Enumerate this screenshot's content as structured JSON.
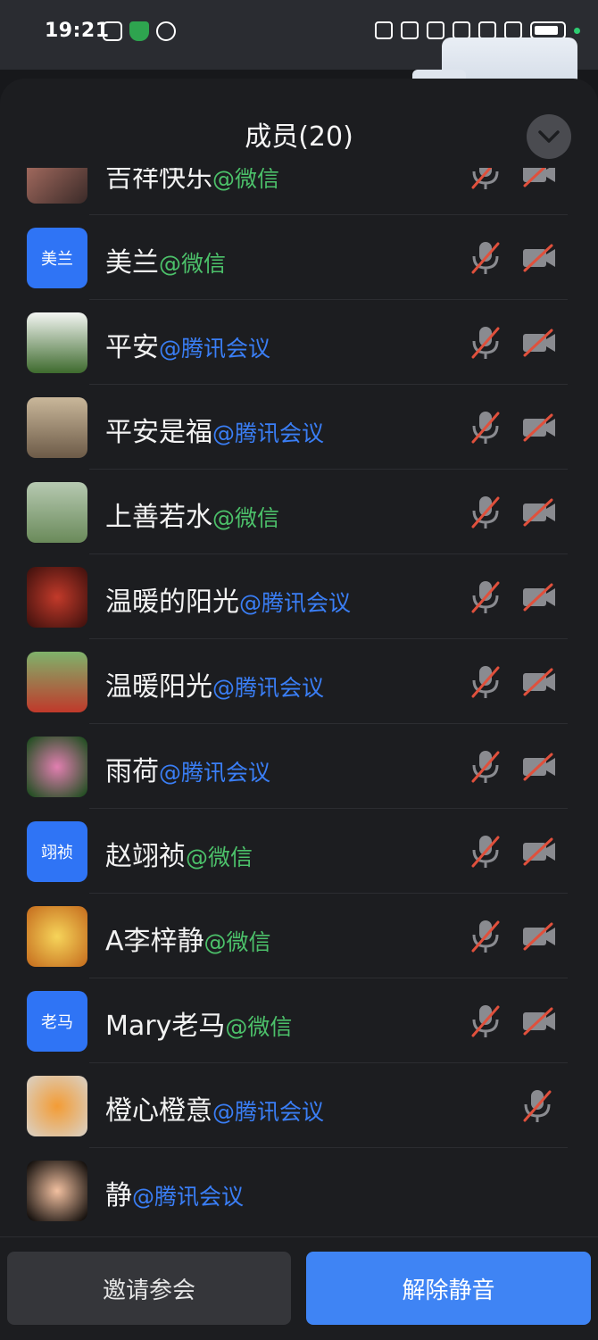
{
  "status_bar": {
    "time": "19:21",
    "left_icons": [
      "chat-app-icon",
      "shield-icon",
      "hand-icon"
    ],
    "right_icons": [
      "nfc-icon",
      "alarm-icon",
      "bluetooth-icon",
      "wifi-icon",
      "hd-icon",
      "5g-signal-icon",
      "battery-icon"
    ]
  },
  "panel": {
    "title": "成员(20)",
    "collapse_icon": "chevron-down-icon"
  },
  "members": [
    {
      "name": "吉祥快乐",
      "source": "@微信",
      "type": "wechat",
      "avatar_kind": "photo",
      "mic_muted": true,
      "camera_off": true
    },
    {
      "name": "美兰",
      "source": "@微信",
      "type": "wechat",
      "avatar_kind": "text",
      "avatar_text": "美兰",
      "mic_muted": true,
      "camera_off": true
    },
    {
      "name": "平安",
      "source": "@腾讯会议",
      "type": "tencent",
      "avatar_kind": "photo",
      "mic_muted": true,
      "camera_off": true
    },
    {
      "name": "平安是福",
      "source": "@腾讯会议",
      "type": "tencent",
      "avatar_kind": "photo",
      "mic_muted": true,
      "camera_off": true
    },
    {
      "name": "上善若水",
      "source": "@微信",
      "type": "wechat",
      "avatar_kind": "photo",
      "mic_muted": true,
      "camera_off": true
    },
    {
      "name": "温暖的阳光",
      "source": "@腾讯会议",
      "type": "tencent",
      "avatar_kind": "photo",
      "mic_muted": true,
      "camera_off": true
    },
    {
      "name": "温暖阳光",
      "source": "@腾讯会议",
      "type": "tencent",
      "avatar_kind": "photo",
      "mic_muted": true,
      "camera_off": true
    },
    {
      "name": "雨荷",
      "source": "@腾讯会议",
      "type": "tencent",
      "avatar_kind": "photo",
      "mic_muted": true,
      "camera_off": true
    },
    {
      "name": "赵翊祯",
      "source": "@微信",
      "type": "wechat",
      "avatar_kind": "text",
      "avatar_text": "翊祯",
      "mic_muted": true,
      "camera_off": true
    },
    {
      "name": "A李梓静",
      "source": "@微信",
      "type": "wechat",
      "avatar_kind": "photo",
      "mic_muted": true,
      "camera_off": true
    },
    {
      "name": "Mary老马",
      "source": "@微信",
      "type": "wechat",
      "avatar_kind": "text",
      "avatar_text": "老马",
      "mic_muted": true,
      "camera_off": true
    },
    {
      "name": "橙心橙意",
      "source": "@腾讯会议",
      "type": "tencent",
      "avatar_kind": "photo",
      "mic_muted": true,
      "camera_off": false
    },
    {
      "name": "静",
      "source": "@腾讯会议",
      "type": "tencent",
      "avatar_kind": "photo",
      "mic_muted": false,
      "camera_off": false
    }
  ],
  "buttons": {
    "invite": "邀请参会",
    "unmute": "解除静音"
  },
  "colors": {
    "wechat_source": "#4cc16a",
    "tencent_source": "#3a7ef5",
    "primary_button": "#3f84f4",
    "muted_slash": "#e0503c"
  }
}
